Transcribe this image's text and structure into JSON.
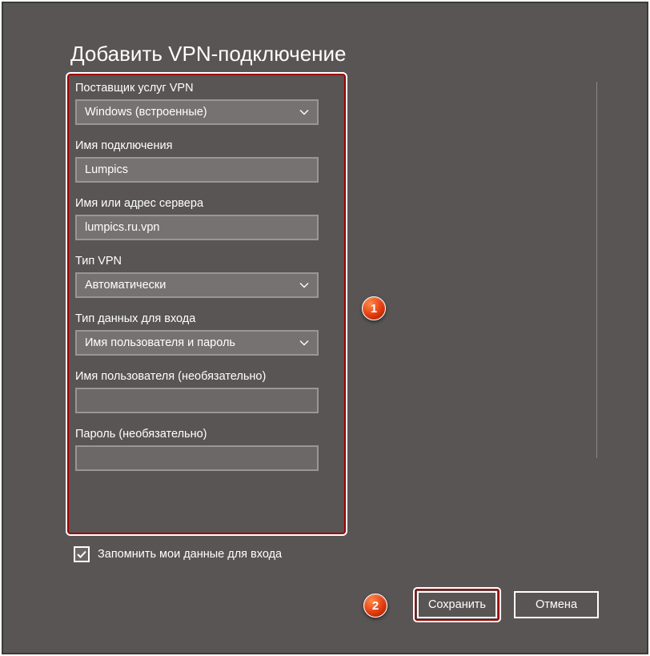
{
  "title": "Добавить VPN-подключение",
  "fields": {
    "provider": {
      "label": "Поставщик услуг VPN",
      "value": "Windows (встроенные)"
    },
    "conn_name": {
      "label": "Имя подключения",
      "value": "Lumpics"
    },
    "server": {
      "label": "Имя или адрес сервера",
      "value": "lumpics.ru.vpn"
    },
    "vpn_type": {
      "label": "Тип VPN",
      "value": "Автоматически"
    },
    "signin_type": {
      "label": "Тип данных для входа",
      "value": "Имя пользователя и пароль"
    },
    "username": {
      "label": "Имя пользователя (необязательно)",
      "value": ""
    },
    "password": {
      "label": "Пароль (необязательно)",
      "value": ""
    }
  },
  "remember": {
    "label": "Запомнить мои данные для входа",
    "checked": true
  },
  "buttons": {
    "save": "Сохранить",
    "cancel": "Отмена"
  },
  "markers": {
    "one": "1",
    "two": "2"
  }
}
